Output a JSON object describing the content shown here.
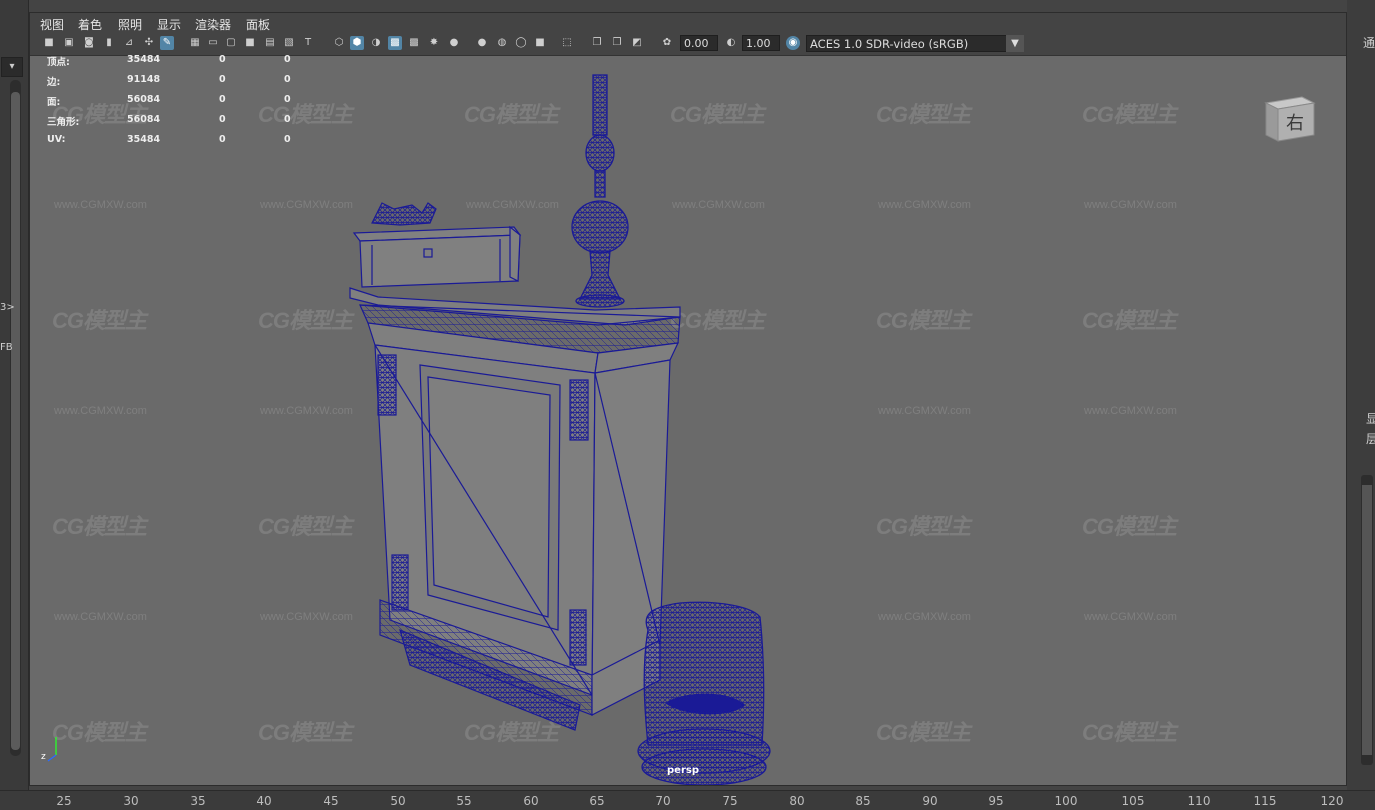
{
  "viewport_menu": [
    "视图",
    "着色",
    "照明",
    "显示",
    "渲染器",
    "面板"
  ],
  "toolbar": {
    "exposure_value": "0.00",
    "gamma_value": "1.00",
    "color_space": "ACES 1.0 SDR-video (sRGB)"
  },
  "hud_stats": [
    {
      "label": "顶点:",
      "value": "35484",
      "sel_a": "0",
      "sel_b": "0"
    },
    {
      "label": "边:",
      "value": "91148",
      "sel_a": "0",
      "sel_b": "0"
    },
    {
      "label": "面:",
      "value": "56084",
      "sel_a": "0",
      "sel_b": "0"
    },
    {
      "label": "三角形:",
      "value": "56084",
      "sel_a": "0",
      "sel_b": "0"
    },
    {
      "label": "UV:",
      "value": "35484",
      "sel_a": "0",
      "sel_b": "0"
    }
  ],
  "view_cube_label": "右",
  "camera_label": "persp",
  "axis_label": "z",
  "watermark": {
    "logo_text": "CG模型主",
    "url_text": "www.CGMXW.com"
  },
  "left_side_fragments": [
    "3>",
    "FB"
  ],
  "right_side_fragments": [
    "通",
    "显",
    "层"
  ],
  "timeline_ticks": [
    "25",
    "30",
    "35",
    "40",
    "45",
    "50",
    "55",
    "60",
    "65",
    "70",
    "75",
    "80",
    "85",
    "90",
    "95",
    "100",
    "105",
    "110",
    "115",
    "120"
  ],
  "colors": {
    "wireframe": "#1a1a96",
    "mesh_fill": "#808080",
    "viewport_bg": "#6a6a6a",
    "toolbar_active": "#5285a6"
  },
  "icons": [
    "camera-icon",
    "grid-icon",
    "wireframe-shading-icon",
    "smooth-shading-icon",
    "light-icon",
    "isolate-select-icon",
    "xray-icon",
    "exposure-icon",
    "gamma-icon",
    "color-management-icon"
  ]
}
